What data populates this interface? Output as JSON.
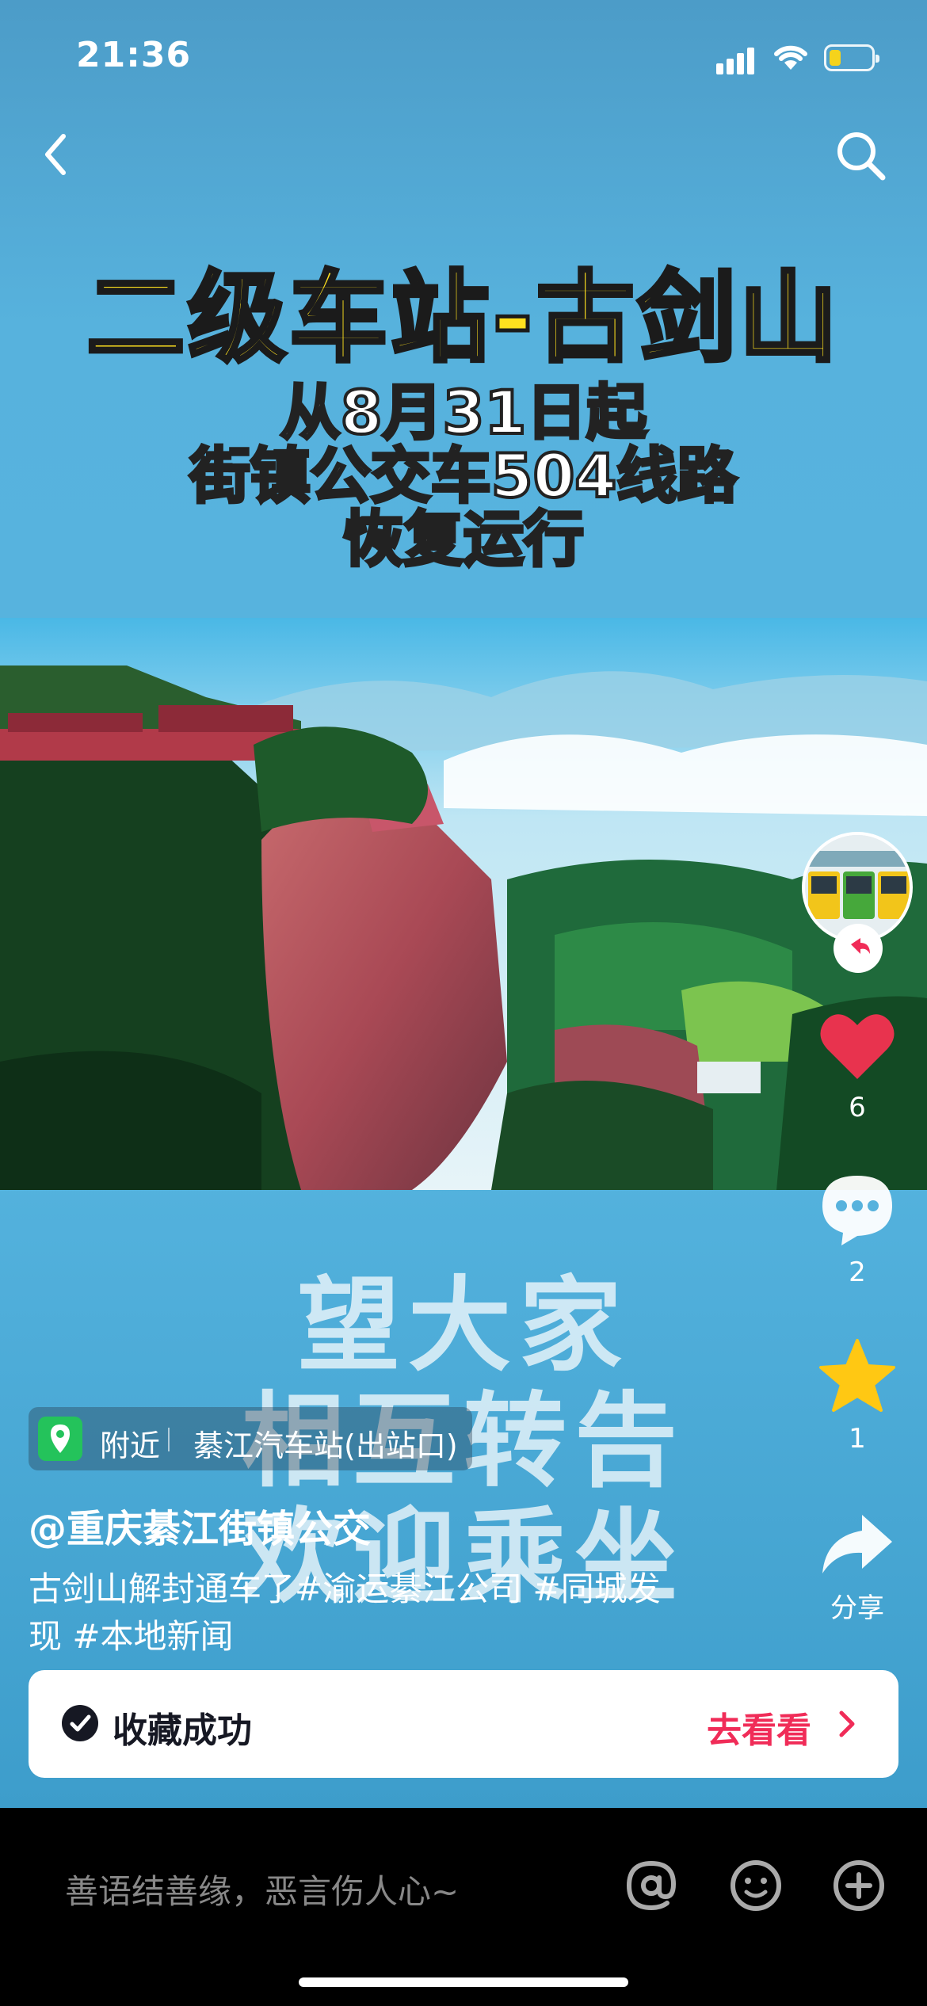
{
  "status_bar": {
    "time": "21:36"
  },
  "nav": {
    "back": "back-icon",
    "search": "search-icon"
  },
  "video": {
    "title": "二级车站-古剑山",
    "subtitle_lines": [
      "从8月31日起",
      "街镇公交车504线路",
      "恢复运行"
    ],
    "caption_lines": [
      "望大家",
      "相互转告",
      "欢迎乘坐"
    ]
  },
  "sidebar": {
    "likes": "6",
    "comments": "2",
    "favorites": "1",
    "share_label": "分享"
  },
  "info": {
    "location_tag": "附近",
    "location_name": "綦江汽车站(出站口)",
    "author": "@重庆綦江街镇公交",
    "description": "古剑山解封通车了#渝运綦江公司 #同城发现 #本地新闻"
  },
  "toast": {
    "message": "收藏成功",
    "action": "去看看"
  },
  "comment_bar": {
    "placeholder": "善语结善缘，恶言伤人心~"
  },
  "colors": {
    "accent_red": "#f02c58",
    "like_red": "#e8334e",
    "star_yellow": "#ffc813",
    "title_yellow": "#ffe11f"
  }
}
